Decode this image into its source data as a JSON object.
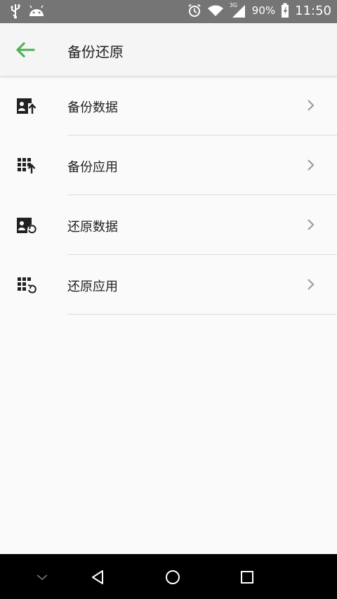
{
  "status_bar": {
    "battery_percent": "90%",
    "time": "11:50",
    "network_label": "3G",
    "icons": [
      "usb-icon",
      "android-icon",
      "alarm-icon",
      "wifi-icon",
      "signal-icon",
      "battery-charging-icon"
    ]
  },
  "toolbar": {
    "title": "备份还原",
    "back_icon": "arrow-left-icon",
    "accent_color": "#4caf50"
  },
  "items": [
    {
      "label": "备份数据",
      "icon": "contact-card-upload-icon"
    },
    {
      "label": "备份应用",
      "icon": "app-grid-upload-icon"
    },
    {
      "label": "还原数据",
      "icon": "contact-card-restore-icon"
    },
    {
      "label": "还原应用",
      "icon": "app-grid-restore-icon"
    }
  ],
  "nav_bar": {
    "icons": [
      "chevron-down-icon",
      "back-triangle-icon",
      "home-circle-icon",
      "recents-square-icon"
    ]
  }
}
